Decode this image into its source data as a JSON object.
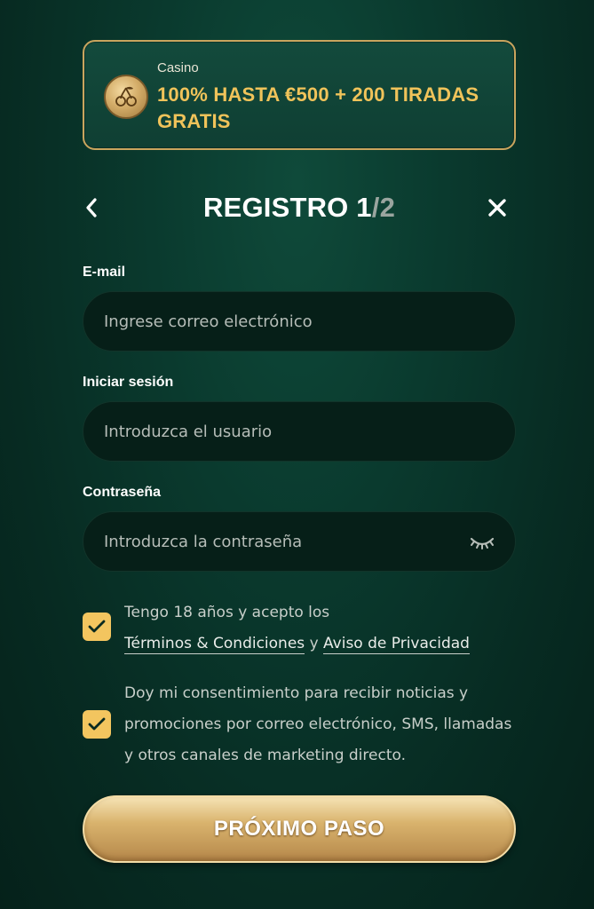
{
  "promo": {
    "category": "Casino",
    "title": "100% HASTA €500 + 200 TIRADAS GRATIS",
    "icon": "cherry-icon"
  },
  "header": {
    "title_main": "REGISTRO 1",
    "title_total": "/2",
    "back_icon": "chevron-left-icon",
    "close_icon": "close-icon"
  },
  "form": {
    "email": {
      "label": "E-mail",
      "placeholder": "Ingrese correo electrónico",
      "value": ""
    },
    "login": {
      "label": "Iniciar sesión",
      "placeholder": "Introduzca el usuario",
      "value": ""
    },
    "password": {
      "label": "Contraseña",
      "placeholder": "Introduzca la contraseña",
      "value": "",
      "toggle_icon": "eye-closed-icon"
    }
  },
  "consents": {
    "terms": {
      "checked": true,
      "text_prefix": "Tengo 18 años y acepto los",
      "terms_link": "Términos & Condiciones",
      "conjunction": "y",
      "privacy_link": "Aviso de Privacidad"
    },
    "marketing": {
      "checked": true,
      "text": "Doy mi consentimiento para recibir noticias y promociones por correo electrónico, SMS, llamadas y otros canales de marketing directo."
    }
  },
  "actions": {
    "next_label": "PRÓXIMO PASO"
  },
  "colors": {
    "accent_gold": "#f0c35a",
    "checkbox": "#f3c55f",
    "background": "#0a3a2e",
    "field_bg": "#061f18"
  }
}
